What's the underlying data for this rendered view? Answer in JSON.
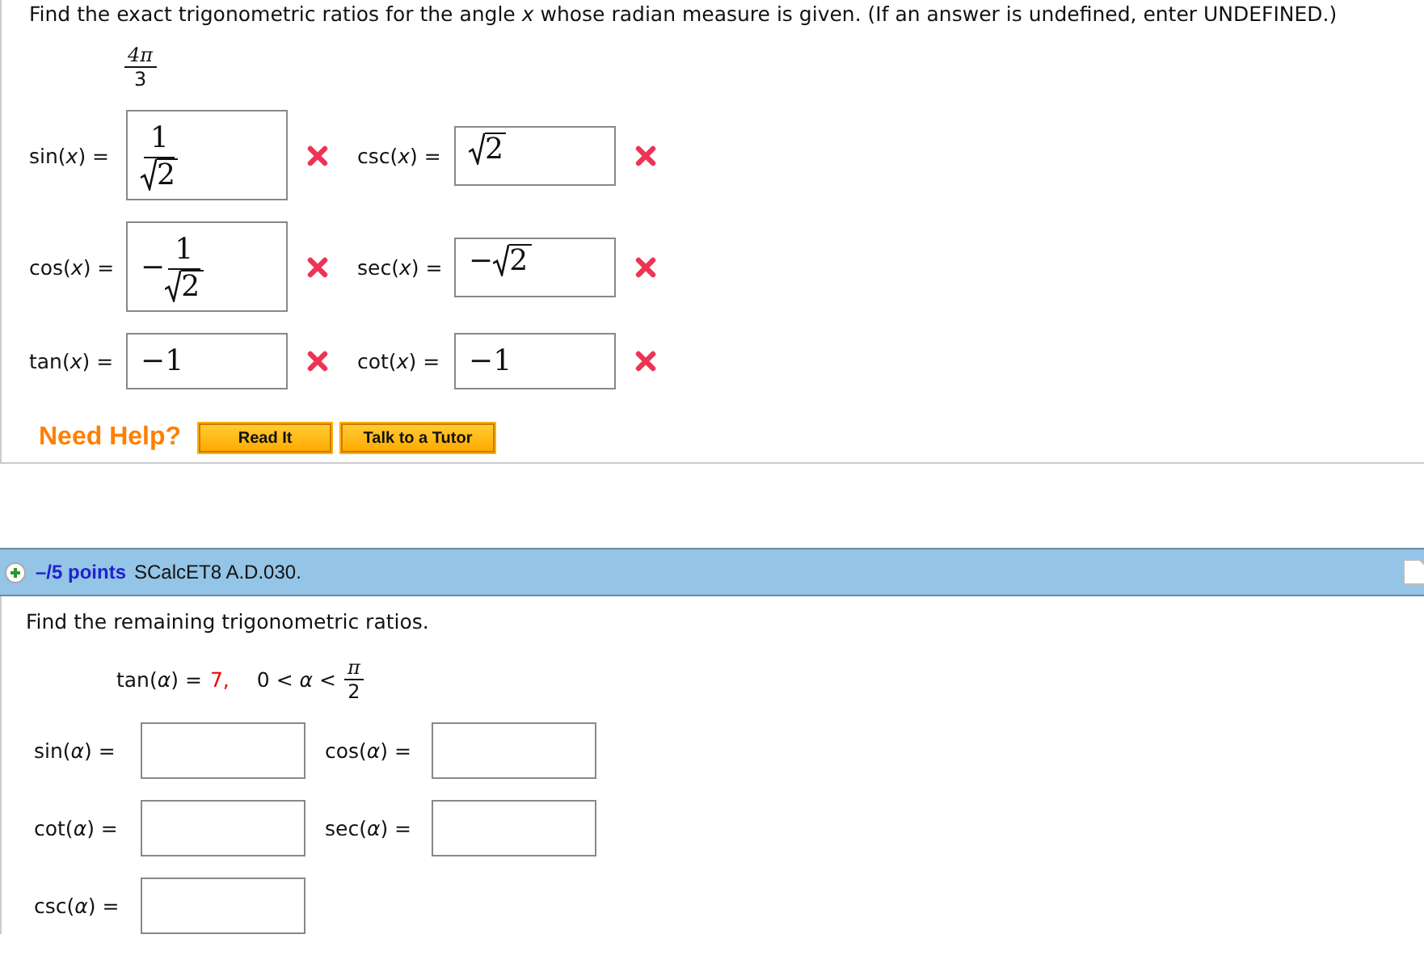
{
  "question1": {
    "prompt": "Find the exact trigonometric ratios for the angle *x* whose radian measure is given. (If an answer is undefined, enter UNDEFINED.)",
    "angle": {
      "numerator": "4π",
      "denominator": "3"
    },
    "answers": [
      {
        "label": "sin(*x*) =",
        "kind": "frac_sqrt",
        "numerator": "1",
        "radicand": "2",
        "correct": false
      },
      {
        "label": "csc(*x*) =",
        "kind": "sqrt",
        "radicand": "2",
        "correct": false
      },
      {
        "label": "cos(*x*) =",
        "kind": "frac_sqrt",
        "sign": "−",
        "numerator": "1",
        "radicand": "2",
        "correct": false
      },
      {
        "label": "sec(*x*) =",
        "kind": "sqrt",
        "sign": "−",
        "radicand": "2",
        "correct": false
      },
      {
        "label": "tan(*x*) =",
        "kind": "plain",
        "value": "−1",
        "correct": false
      },
      {
        "label": "cot(*x*) =",
        "kind": "plain",
        "value": "−1",
        "correct": false
      }
    ],
    "help": {
      "label": "Need Help?",
      "buttons": [
        "Read It",
        "Talk to a Tutor"
      ]
    }
  },
  "question2": {
    "points": "–/5 points",
    "code": "SCalcET8 A.D.030.",
    "prompt": "Find the remaining trigonometric ratios.",
    "given": {
      "lhs": "tan(*α*) =",
      "value": "7,",
      "condition": "0 < *α* <",
      "numerator": "π",
      "denominator": "2"
    },
    "fields": [
      {
        "label": "sin(*α*)  ="
      },
      {
        "label": "cos(*α*)  ="
      },
      {
        "label": "cot(*α*) ="
      },
      {
        "label": "sec(*α*)  ="
      },
      {
        "label": "csc(*α*)  ="
      }
    ]
  }
}
